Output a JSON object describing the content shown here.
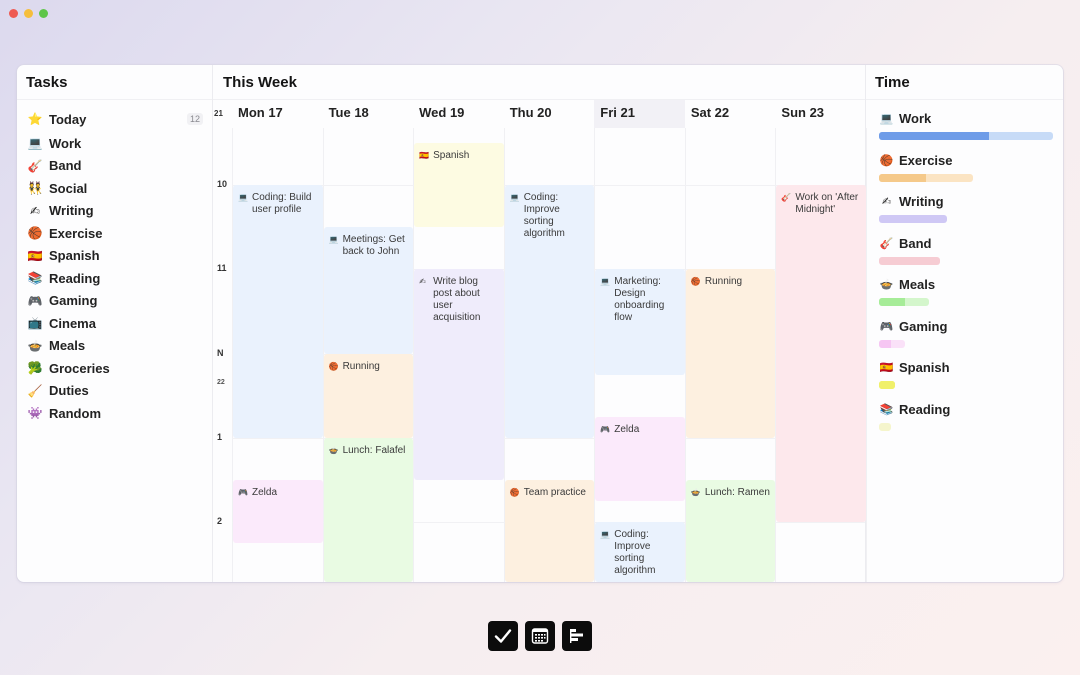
{
  "window": {
    "controls": [
      "close",
      "minimize",
      "maximize"
    ]
  },
  "tasks": {
    "title": "Tasks",
    "items": [
      {
        "icon": "⭐",
        "icon_name": "star-icon",
        "label": "Today",
        "badge": "12"
      },
      {
        "icon": "💻",
        "icon_name": "laptop-icon",
        "label": "Work"
      },
      {
        "icon": "🎸",
        "icon_name": "guitar-icon",
        "label": "Band"
      },
      {
        "icon": "👯",
        "icon_name": "people-icon",
        "label": "Social"
      },
      {
        "icon": "✍",
        "icon_name": "writing-hand-icon",
        "label": "Writing"
      },
      {
        "icon": "🏀",
        "icon_name": "basketball-icon",
        "label": "Exercise"
      },
      {
        "icon": "🇪🇸",
        "icon_name": "spain-flag-icon",
        "label": "Spanish"
      },
      {
        "icon": "📚",
        "icon_name": "books-icon",
        "label": "Reading"
      },
      {
        "icon": "🎮",
        "icon_name": "gamepad-icon",
        "label": "Gaming"
      },
      {
        "icon": "📺",
        "icon_name": "tv-icon",
        "label": "Cinema"
      },
      {
        "icon": "🍲",
        "icon_name": "bowl-icon",
        "label": "Meals"
      },
      {
        "icon": "🥦",
        "icon_name": "broccoli-icon",
        "label": "Groceries"
      },
      {
        "icon": "🧹",
        "icon_name": "broom-icon",
        "label": "Duties"
      },
      {
        "icon": "👾",
        "icon_name": "alien-icon",
        "label": "Random"
      }
    ]
  },
  "week": {
    "title": "This Week",
    "week_number": "21",
    "days": [
      {
        "label": "Mon 17",
        "today": false
      },
      {
        "label": "Tue 18",
        "today": false
      },
      {
        "label": "Wed 19",
        "today": false
      },
      {
        "label": "Thu 20",
        "today": false
      },
      {
        "label": "Fri 21",
        "today": true
      },
      {
        "label": "Sat 22",
        "today": false
      },
      {
        "label": "Sun 23",
        "today": false
      }
    ],
    "hour_labels": [
      {
        "label": "10",
        "hour": 10
      },
      {
        "label": "11",
        "hour": 11
      },
      {
        "label": "N",
        "hour": 12
      },
      {
        "label": "1",
        "hour": 13
      },
      {
        "label": "2",
        "hour": 14
      }
    ],
    "week_marker": {
      "label": "22",
      "hour": 12.35
    },
    "visible_range": [
      9.32,
      14.72
    ],
    "categories": {
      "work": {
        "icon": "💻",
        "icon_name": "laptop-icon",
        "bg": "#eaf2fd"
      },
      "exercise": {
        "icon": "🏀",
        "icon_name": "basketball-icon",
        "bg": "#fdf0e0"
      },
      "writing": {
        "icon": "✍",
        "icon_name": "writing-hand-icon",
        "bg": "#efecfb"
      },
      "band": {
        "icon": "🎸",
        "icon_name": "guitar-icon",
        "bg": "#fde8ec"
      },
      "meals": {
        "icon": "🍲",
        "icon_name": "bowl-icon",
        "bg": "#e9fbe3"
      },
      "gaming": {
        "icon": "🎮",
        "icon_name": "gamepad-icon",
        "bg": "#fbeafb"
      },
      "spanish": {
        "icon": "🇪🇸",
        "icon_name": "spain-flag-icon",
        "bg": "#fdfbe2"
      }
    },
    "events": [
      {
        "day": 0,
        "start": 10.0,
        "end": 13.0,
        "category": "work",
        "title": "Coding: Build user profile"
      },
      {
        "day": 0,
        "start": 13.5,
        "end": 14.25,
        "category": "gaming",
        "title": "Zelda"
      },
      {
        "day": 1,
        "start": 10.5,
        "end": 12.0,
        "category": "work",
        "title": "Meetings: Get back to John"
      },
      {
        "day": 1,
        "start": 12.0,
        "end": 13.0,
        "category": "exercise",
        "title": "Running"
      },
      {
        "day": 1,
        "start": 13.0,
        "end": 14.75,
        "category": "meals",
        "title": "Lunch: Falafel"
      },
      {
        "day": 2,
        "start": 9.5,
        "end": 10.5,
        "category": "spanish",
        "title": "Spanish"
      },
      {
        "day": 2,
        "start": 11.0,
        "end": 13.5,
        "category": "writing",
        "title": "Write blog post about user acquisition"
      },
      {
        "day": 3,
        "start": 10.0,
        "end": 13.0,
        "category": "work",
        "title": "Coding: Improve sorting algorithm"
      },
      {
        "day": 3,
        "start": 13.5,
        "end": 14.75,
        "category": "exercise",
        "title": "Team practice"
      },
      {
        "day": 4,
        "start": 11.0,
        "end": 12.25,
        "category": "work",
        "title": "Marketing: Design onboarding flow"
      },
      {
        "day": 4,
        "start": 12.75,
        "end": 13.75,
        "category": "gaming",
        "title": "Zelda"
      },
      {
        "day": 4,
        "start": 14.0,
        "end": 14.75,
        "category": "work",
        "title": "Coding: Improve sorting algorithm"
      },
      {
        "day": 5,
        "start": 11.0,
        "end": 13.0,
        "category": "exercise",
        "title": "Running"
      },
      {
        "day": 5,
        "start": 13.5,
        "end": 14.75,
        "category": "meals",
        "title": "Lunch: Ramen"
      },
      {
        "day": 6,
        "start": 10.0,
        "end": 14.0,
        "category": "band",
        "title": "Work on 'After Midnight'"
      }
    ]
  },
  "time": {
    "title": "Time",
    "items": [
      {
        "icon": "💻",
        "icon_name": "laptop-icon",
        "label": "Work",
        "total": 1.0,
        "done": 0.63,
        "color": "#6e9ce8",
        "track": "#c7dbf7"
      },
      {
        "icon": "🏀",
        "icon_name": "basketball-icon",
        "label": "Exercise",
        "total": 0.54,
        "done": 0.27,
        "color": "#f5c98a",
        "track": "#fbe4c3"
      },
      {
        "icon": "✍",
        "icon_name": "writing-hand-icon",
        "label": "Writing",
        "total": 0.39,
        "done": 0.0,
        "color": "#c6bdf4",
        "track": "#cfc8f5"
      },
      {
        "icon": "🎸",
        "icon_name": "guitar-icon",
        "label": "Band",
        "total": 0.35,
        "done": 0.0,
        "color": "#f5c4cc",
        "track": "#f6ccd3"
      },
      {
        "icon": "🍲",
        "icon_name": "bowl-icon",
        "label": "Meals",
        "total": 0.29,
        "done": 0.15,
        "color": "#a6ec98",
        "track": "#d4f6cc"
      },
      {
        "icon": "🎮",
        "icon_name": "gamepad-icon",
        "label": "Gaming",
        "total": 0.15,
        "done": 0.07,
        "color": "#f6c6f3",
        "track": "#fae1f8"
      },
      {
        "icon": "🇪🇸",
        "icon_name": "spain-flag-icon",
        "label": "Spanish",
        "total": 0.09,
        "done": 0.09,
        "color": "#f0f06a",
        "track": "#f0f06a"
      },
      {
        "icon": "📚",
        "icon_name": "books-icon",
        "label": "Reading",
        "total": 0.07,
        "done": 0.0,
        "color": "#f3f3c2",
        "track": "#f5f5cc"
      }
    ]
  },
  "dock": {
    "items": [
      {
        "name": "tasks-view-button",
        "icon_name": "checkmark-icon"
      },
      {
        "name": "calendar-view-button",
        "icon_name": "calendar-icon"
      },
      {
        "name": "time-view-button",
        "icon_name": "bar-chart-icon"
      }
    ]
  }
}
